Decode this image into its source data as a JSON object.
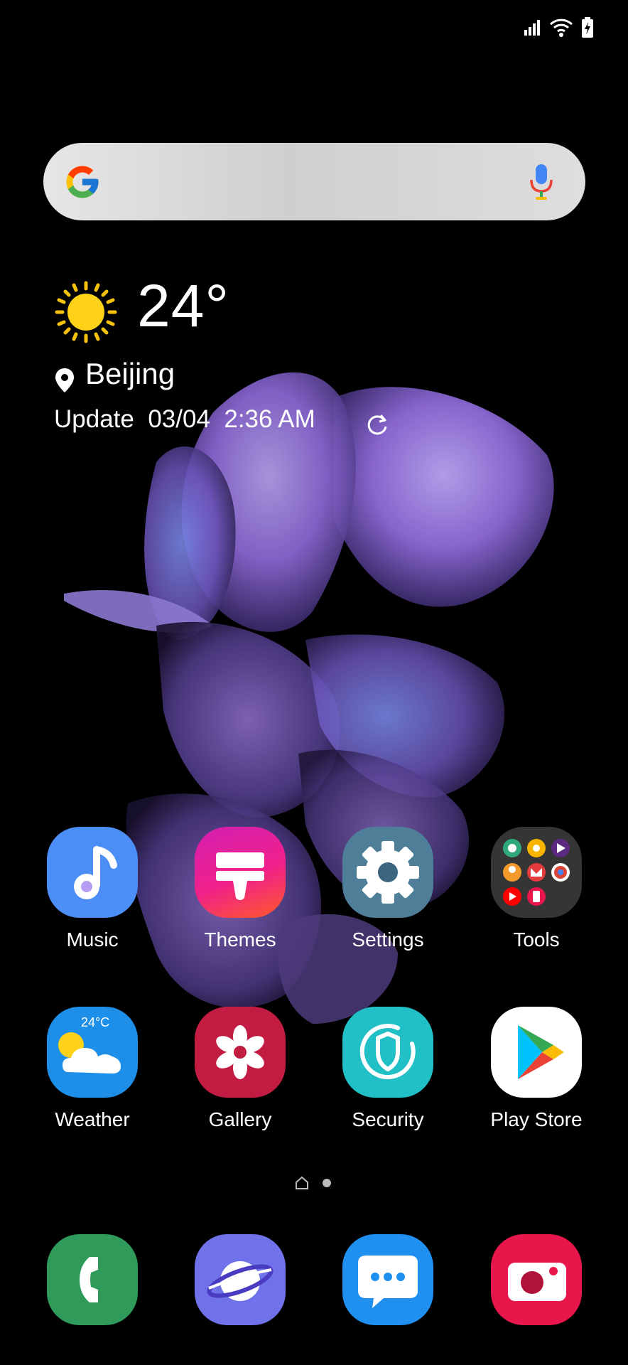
{
  "status_bar": {
    "icons": [
      "signal-icon",
      "wifi-icon",
      "battery-charging-icon"
    ]
  },
  "search": {
    "logo": "google-logo-icon",
    "mic": "microphone-icon"
  },
  "weather_widget": {
    "condition_icon": "sun-icon",
    "temperature": "24°",
    "location": "Beijing",
    "update_label": "Update",
    "update_time": "03/04  2:36 AM"
  },
  "apps_row1": [
    {
      "label": "Music",
      "icon": "music-icon",
      "color": "#4b8ef6"
    },
    {
      "label": "Themes",
      "icon": "themes-brush-icon",
      "color": "#e0289a"
    },
    {
      "label": "Settings",
      "icon": "gear-icon",
      "color": "#4f7e99"
    },
    {
      "label": "Tools",
      "icon": "folder-icon",
      "color": "#3a3a3a"
    }
  ],
  "apps_row2": [
    {
      "label": "Weather",
      "icon": "weather-icon",
      "color": "#1e8fe8",
      "badge": "24°C"
    },
    {
      "label": "Gallery",
      "icon": "gallery-flower-icon",
      "color": "#c21c42"
    },
    {
      "label": "Security",
      "icon": "shield-icon",
      "color": "#21c0c7"
    },
    {
      "label": "Play Store",
      "icon": "play-store-icon",
      "color": "#ffffff"
    }
  ],
  "dock": [
    {
      "name": "Phone",
      "icon": "phone-icon",
      "color": "#2f9a5a"
    },
    {
      "name": "Internet",
      "icon": "internet-planet-icon",
      "color": "#6f72e8"
    },
    {
      "name": "Messages",
      "icon": "messages-icon",
      "color": "#1f8ff0"
    },
    {
      "name": "Camera",
      "icon": "camera-icon",
      "color": "#e7174c"
    }
  ]
}
